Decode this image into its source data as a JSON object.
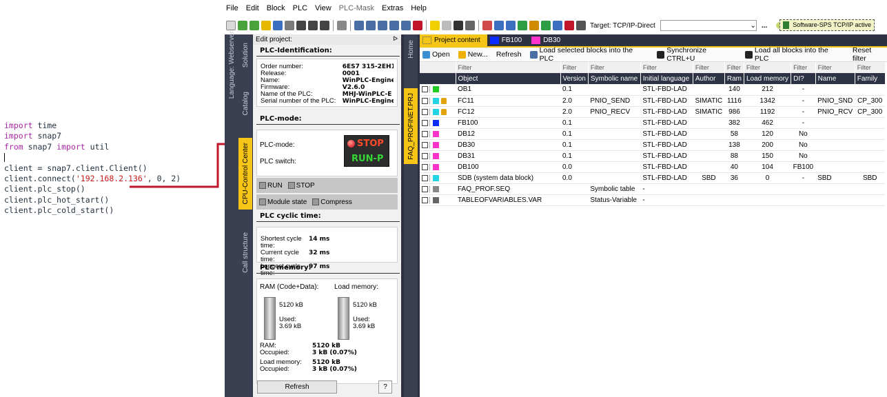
{
  "code": {
    "lines": [
      [
        {
          "t": "import",
          "c": "kw"
        },
        {
          "t": " time",
          "c": ""
        }
      ],
      [
        {
          "t": "import",
          "c": "kw"
        },
        {
          "t": " snap7",
          "c": ""
        }
      ],
      [
        {
          "t": "from",
          "c": "kw"
        },
        {
          "t": " snap7 ",
          "c": ""
        },
        {
          "t": "import",
          "c": "kw"
        },
        {
          "t": " util",
          "c": ""
        }
      ],
      [],
      [
        {
          "t": "client = snap7.client.Client()",
          "c": ""
        }
      ],
      [
        {
          "t": "client.connect(",
          "c": ""
        },
        {
          "t": "'192.168.2.136'",
          "c": "str"
        },
        {
          "t": ", 0, 2)",
          "c": ""
        }
      ],
      [
        {
          "t": "client.plc_stop()",
          "c": ""
        }
      ],
      [
        {
          "t": "client.plc_hot_start()",
          "c": ""
        }
      ],
      [
        {
          "t": "client.plc_cold_start()",
          "c": ""
        }
      ]
    ]
  },
  "menu": [
    "File",
    "Edit",
    "Block",
    "PLC",
    "View",
    "PLC-Mask",
    "Extras",
    "Help"
  ],
  "toolbar": {
    "target_label": "Target: TCP/IP-Direct",
    "target_extra": "...",
    "status_text": "Software-SPS TCP/IP active"
  },
  "left_tabs": [
    "Language: Webserver",
    "Solution",
    "Catalog",
    "CPU-Control Center",
    "Call structure"
  ],
  "home_tab": "Home",
  "project_tab": "FAQ_PROFINET.PRJ",
  "edit_panel": {
    "title": "Edit project:",
    "pin": "ᐅ",
    "identification": {
      "heading": "PLC-Identification:",
      "rows": [
        {
          "k": "Order number:",
          "v": "6ES7 315-2EH1"
        },
        {
          "k": "Release:",
          "v": "0001"
        },
        {
          "k": "Name:",
          "v": "WinPLC-Engine"
        },
        {
          "k": "Firmware:",
          "v": "V2.6.0"
        },
        {
          "k": "Name of the PLC:",
          "v": "MHJ-WinPLC-E"
        },
        {
          "k": "Serial number of the PLC:",
          "v": "WinPLC-Engine"
        }
      ]
    },
    "mode": {
      "heading": "PLC-mode:",
      "mode_label": "PLC-mode:",
      "switch_label": "PLC switch:",
      "stop_text": "STOP",
      "runp_text": "RUN-P",
      "run_button": "RUN",
      "stop_button": "STOP",
      "module_state": "Module state",
      "compress": "Compress"
    },
    "cycle": {
      "heading": "PLC cyclic time:",
      "rows": [
        {
          "k": "Shortest cycle time:",
          "v": "14 ms"
        },
        {
          "k": "Current cycle time:",
          "v": "32 ms"
        },
        {
          "k": "Longest cycle time:",
          "v": "97 ms"
        }
      ]
    },
    "memory": {
      "heading": "PLC memory:",
      "ram_title": "RAM (Code+Data):",
      "load_title": "Load memory:",
      "ram_cap": "5120 kB",
      "load_cap": "5120 kB",
      "ram_used_label": "Used:",
      "ram_used": "3.69 kB",
      "load_used_label": "Used:",
      "load_used": "3.69 kB",
      "summary": [
        {
          "k": "RAM:",
          "v": "5120 kB"
        },
        {
          "k": "Occupied:",
          "v": "3 kB (0.07%)"
        },
        {
          "k": "Load memory:",
          "v": "5120 kB"
        },
        {
          "k": "Occupied:",
          "v": "3 kB (0.07%)"
        }
      ]
    },
    "refresh": "Refresh",
    "help": "?"
  },
  "content_tabs": [
    {
      "label": "Project content",
      "color": "#f5c518"
    },
    {
      "label": "FB100",
      "color": "#0b2cff"
    },
    {
      "label": "DB30",
      "color": "#ff33cc"
    }
  ],
  "content_toolbar": [
    "Open",
    "New...",
    "Refresh",
    "Load selected blocks into the PLC",
    "Synchronize CTRL+U",
    "Load all blocks into the PLC",
    "Reset filter"
  ],
  "table": {
    "filters": [
      "",
      "Filter",
      "Filter",
      "Filter",
      "Filter",
      "Filter",
      "Filter",
      "Filter",
      "Filter",
      "Filter",
      "Filter"
    ],
    "columns": [
      "",
      "Object",
      "Version",
      "Symbolic name",
      "Initial language",
      "Author",
      "Ram",
      "Load memory",
      "DI?",
      "Name",
      "Family"
    ],
    "rows": [
      {
        "color": "#22cc22",
        "lock": false,
        "cells": [
          "OB1",
          "0.1",
          "",
          "STL-FBD-LAD",
          "",
          "140",
          "212",
          "-",
          "",
          ""
        ]
      },
      {
        "color": "#22d4e6",
        "lock": true,
        "cells": [
          "FC11",
          "2.0",
          "PNIO_SEND",
          "STL-FBD-LAD",
          "SIMATIC",
          "1116",
          "1342",
          "-",
          "PNIO_SND",
          "CP_300"
        ]
      },
      {
        "color": "#22d4e6",
        "lock": true,
        "cells": [
          "FC12",
          "2.0",
          "PNIO_RECV",
          "STL-FBD-LAD",
          "SIMATIC",
          "986",
          "1192",
          "-",
          "PNIO_RCV",
          "CP_300"
        ]
      },
      {
        "color": "#0b2cff",
        "lock": false,
        "cells": [
          "FB100",
          "0.1",
          "",
          "STL-FBD-LAD",
          "",
          "382",
          "462",
          "-",
          "",
          ""
        ]
      },
      {
        "color": "#ff33cc",
        "lock": false,
        "cells": [
          "DB12",
          "0.1",
          "",
          "STL-FBD-LAD",
          "",
          "58",
          "120",
          "No",
          "",
          ""
        ]
      },
      {
        "color": "#ff33cc",
        "lock": false,
        "cells": [
          "DB30",
          "0.1",
          "",
          "STL-FBD-LAD",
          "",
          "138",
          "200",
          "No",
          "",
          ""
        ]
      },
      {
        "color": "#ff33cc",
        "lock": false,
        "cells": [
          "DB31",
          "0.1",
          "",
          "STL-FBD-LAD",
          "",
          "88",
          "150",
          "No",
          "",
          ""
        ]
      },
      {
        "color": "#ff33cc",
        "lock": false,
        "cells": [
          "DB100",
          "0.0",
          "",
          "STL-FBD-LAD",
          "",
          "40",
          "104",
          "FB100",
          "",
          ""
        ]
      },
      {
        "color": "#22d4e6",
        "lock": false,
        "cells": [
          "SDB (system data block)",
          "0.0",
          "",
          "STL-FBD-LAD",
          "SBD",
          "36",
          "0",
          "-",
          "SBD",
          "SBD"
        ]
      },
      {
        "color": "#888888",
        "lock": false,
        "cells": [
          "FAQ_PROF.SEQ",
          "",
          "Symbolic table",
          "-",
          "",
          "",
          "",
          "",
          "",
          ""
        ]
      },
      {
        "color": "#666666",
        "lock": false,
        "cells": [
          "TABLEOFVARIABLES.VAR",
          "",
          "Status-Variable",
          "-",
          "",
          "",
          "",
          "",
          "",
          ""
        ]
      }
    ]
  },
  "colors": {
    "accent": "#f5c518",
    "frame": "#2d3142",
    "arrow": "#c0152a"
  }
}
